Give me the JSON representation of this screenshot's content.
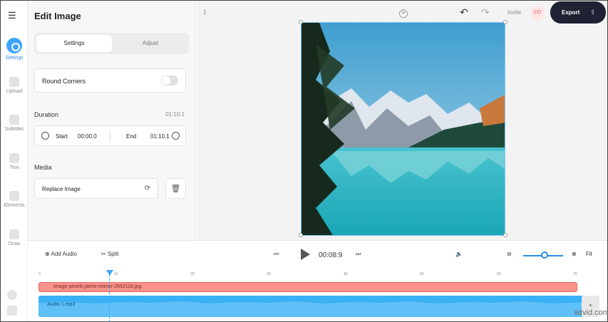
{
  "rail": {
    "items": [
      {
        "label": "Settings",
        "icon": "settings-icon"
      },
      {
        "label": "Upload",
        "icon": "upload-icon"
      },
      {
        "label": "Subtitles",
        "icon": "subtitles-icon"
      },
      {
        "label": "Text",
        "icon": "text-icon"
      },
      {
        "label": "Elements",
        "icon": "elements-icon"
      },
      {
        "label": "Draw",
        "icon": "draw-icon"
      }
    ]
  },
  "panel": {
    "title": "Edit Image",
    "tabs": [
      "Settings",
      "Adjust"
    ],
    "round_corners_label": "Round Corners",
    "duration_label": "Duration",
    "duration_value": "01:10.1",
    "start_label": "Start",
    "start_value": "00:00.0",
    "end_label": "End",
    "end_value": "01:10.1",
    "media_label": "Media",
    "replace_label": "Replace Image"
  },
  "canvas": {
    "page_number": "1",
    "invite_label": "Invite",
    "avatar_initials": "CO",
    "export_label": "Export"
  },
  "timeline": {
    "add_audio_label": "Add Audio",
    "split_label": "Split",
    "current_time": "00:08:9",
    "fit_label": "Fit",
    "ticks": [
      "0",
      "10",
      "20",
      "30",
      "40",
      "50",
      "60",
      "70"
    ],
    "image_track_label": "Image pexels-jaime-reimer-2662116.jpg",
    "audio_track_label": "Audio 1.mp3",
    "add_track_label": "+"
  },
  "watermark": "wtvid.com",
  "colors": {
    "accent": "#3da5ff",
    "export_bg": "#1e2233",
    "image_track": "#f8928a",
    "audio_track": "#3ab0f5"
  }
}
